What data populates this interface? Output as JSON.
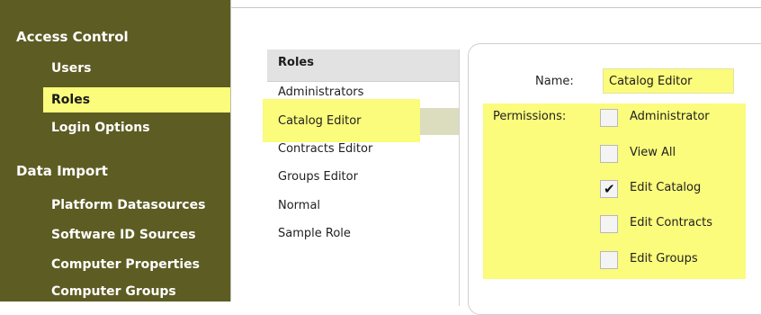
{
  "sidebar": {
    "sections": [
      {
        "title": "Access Control",
        "items": [
          "Users",
          "Roles",
          "Login Options"
        ]
      },
      {
        "title": "Data Import",
        "items": [
          "Platform Datasources",
          "Software ID Sources",
          "Computer Properties",
          "Computer Groups"
        ]
      }
    ],
    "selected_item": "Roles"
  },
  "roles": {
    "header": "Roles",
    "items": [
      "Administrators",
      "Catalog Editor",
      "Contracts Editor",
      "Groups Editor",
      "Normal",
      "Sample Role"
    ],
    "selected": "Catalog Editor"
  },
  "details": {
    "name_label": "Name:",
    "name_value": "Catalog Editor",
    "permissions_label": "Permissions:",
    "permissions": [
      {
        "label": "Administrator",
        "checked": false
      },
      {
        "label": "View All",
        "checked": false
      },
      {
        "label": "Edit Catalog",
        "checked": true
      },
      {
        "label": "Edit Contracts",
        "checked": false
      },
      {
        "label": "Edit Groups",
        "checked": false
      }
    ]
  },
  "colors": {
    "sidebar_bg": "#5d5c23",
    "highlight": "#fbfb7c",
    "selected_row": "#dcdcbf"
  }
}
